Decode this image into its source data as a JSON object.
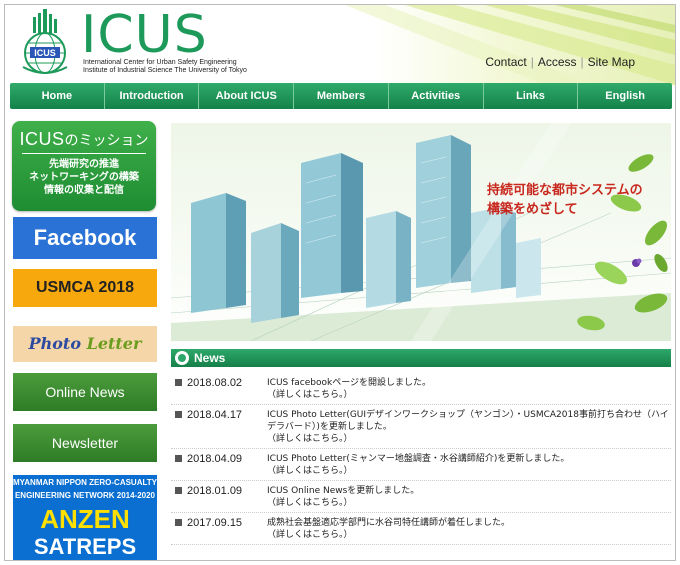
{
  "header": {
    "logo_text": "ICUS",
    "logo_badge": "ICUS",
    "org_line1": "International Center for Urban Safety Engineering",
    "org_line2": "Institute of Industrial Science The University of Tokyo",
    "top_links": [
      "Contact",
      "Access",
      "Site Map"
    ]
  },
  "nav": {
    "items": [
      "Home",
      "Introduction",
      "About ICUS",
      "Members",
      "Activities",
      "Links",
      "English"
    ]
  },
  "sidebar": {
    "mission_title_main": "ICUS",
    "mission_title_suffix": "のミッション",
    "mission_items": [
      "先端研究の推進",
      "ネットワーキングの構築",
      "情報の収集と配信"
    ],
    "facebook": "Facebook",
    "usmca": "USMCA 2018",
    "photo_word1": "Photo",
    "photo_word2": "Letter",
    "online_news": "Online News",
    "newsletter": "Newsletter",
    "anzen_line1": "MYANMAR NIPPON ZERO-CASUALTY",
    "anzen_line2": "ENGINEERING NETWORK 2014-2020",
    "anzen_title": "ANZEN",
    "anzen_sub": "SATREPS"
  },
  "hero": {
    "line1": "持続可能な都市システムの",
    "line2": "構築をめざして"
  },
  "news": {
    "title": "News",
    "items": [
      {
        "date": "2018.08.02",
        "text": "ICUS facebookページを開設しました。",
        "more": "（詳しくはこちら。）"
      },
      {
        "date": "2018.04.17",
        "text": "ICUS Photo Letter(GUIデザインワークショップ（ヤンゴン）・USMCA2018事前打ち合わせ（ハイデラバード）)を更新しました。",
        "more": "（詳しくはこちら。）"
      },
      {
        "date": "2018.04.09",
        "text": "ICUS Photo Letter(ミャンマー地盤調査・水谷講師紹介)を更新しました。",
        "more": "（詳しくはこちら。）"
      },
      {
        "date": "2018.01.09",
        "text": "ICUS Online Newsを更新しました。",
        "more": "（詳しくはこちら。）"
      },
      {
        "date": "2017.09.15",
        "text": "成熟社会基盤適応学部門に水谷司特任講師が着任しました。",
        "more": "（詳しくはこちら。）"
      }
    ]
  },
  "colors": {
    "brand_green": "#1d9a5a",
    "nav_green": "#14824a",
    "facebook_blue": "#2a72d6",
    "usmca_orange": "#f6a80c",
    "hero_red": "#c8281e"
  }
}
